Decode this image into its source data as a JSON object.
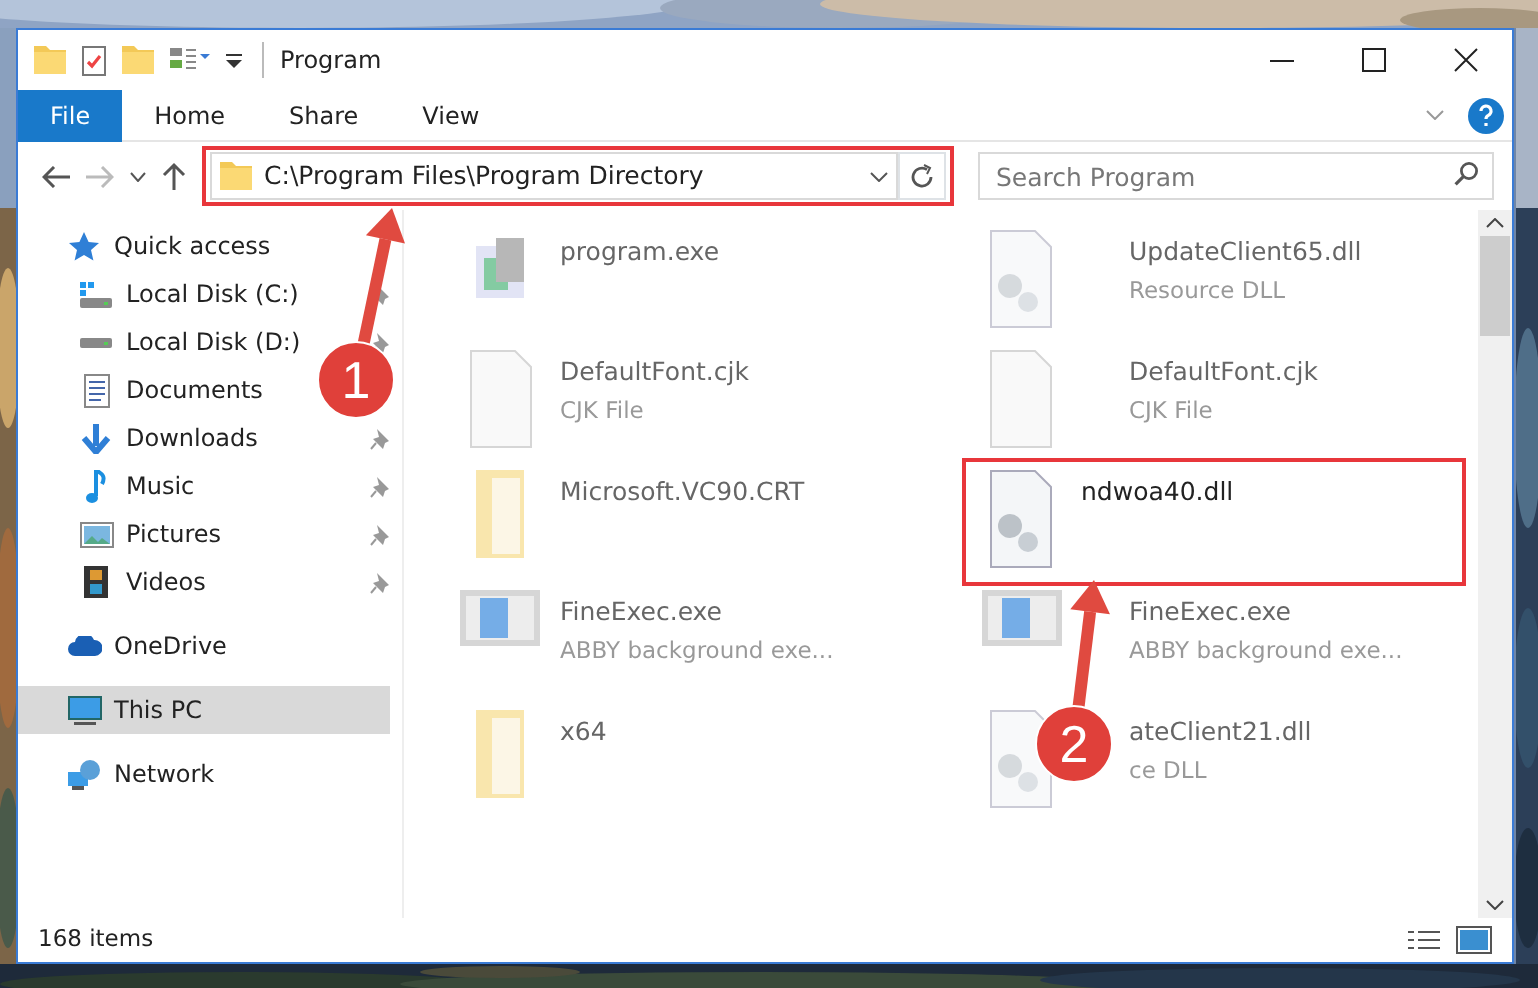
{
  "window": {
    "title": "Program"
  },
  "ribbon_tabs": [
    {
      "label": "File",
      "selected": true
    },
    {
      "label": "Home",
      "selected": false
    },
    {
      "label": "Share",
      "selected": false
    },
    {
      "label": "View",
      "selected": false
    }
  ],
  "address": {
    "path": "C:\\Program Files\\Program Directory",
    "highlighted": true
  },
  "search": {
    "placeholder": "Search Program"
  },
  "nav": [
    {
      "label": "Quick access",
      "selected": false,
      "children": [
        {
          "label": "Local Disk (C:)",
          "pinned": true
        },
        {
          "label": "Local Disk (D:)",
          "pinned": true
        },
        {
          "label": "Documents"
        },
        {
          "label": "Downloads",
          "pinned": true
        },
        {
          "label": "Music",
          "pinned": true
        },
        {
          "label": "Pictures",
          "pinned": true
        },
        {
          "label": "Videos",
          "pinned": true
        }
      ]
    },
    {
      "label": "OneDrive",
      "selected": false
    },
    {
      "label": "This PC",
      "selected": true
    },
    {
      "label": "Network",
      "selected": false
    }
  ],
  "files": [
    {
      "name": "program.exe",
      "kind": "app",
      "blurred": true,
      "highlighted": false
    },
    {
      "name": "UpdateClient65.dll",
      "type": "Resource DLL",
      "kind": "dll",
      "blurred": true,
      "highlighted": false
    },
    {
      "name": "DefaultFont.cjk",
      "type": "CJK File",
      "kind": "file",
      "blurred": true,
      "highlighted": false
    },
    {
      "name": "DefaultFont.cjk",
      "type": "CJK File",
      "kind": "file",
      "blurred": true,
      "highlighted": false
    },
    {
      "name": "Microsoft.VC90.CRT",
      "kind": "folder",
      "blurred": true,
      "highlighted": false
    },
    {
      "name": "ndwoa40.dll",
      "kind": "dll",
      "blurred": false,
      "highlighted": true
    },
    {
      "name": "FineExec.exe",
      "type": "ABBY background exe...",
      "kind": "exe",
      "blurred": true,
      "highlighted": false
    },
    {
      "name": "FineExec.exe",
      "type": "ABBY background exe...",
      "kind": "exe",
      "blurred": true,
      "highlighted": false
    },
    {
      "name": "x64",
      "kind": "folder",
      "blurred": true,
      "highlighted": false
    },
    {
      "name": "ateClient21.dll",
      "type": "ce DLL",
      "kind": "dll",
      "blurred": true,
      "highlighted": false
    }
  ],
  "status_bar": {
    "item_count": "168 items"
  },
  "callouts": [
    {
      "label": "1"
    },
    {
      "label": "2"
    }
  ]
}
